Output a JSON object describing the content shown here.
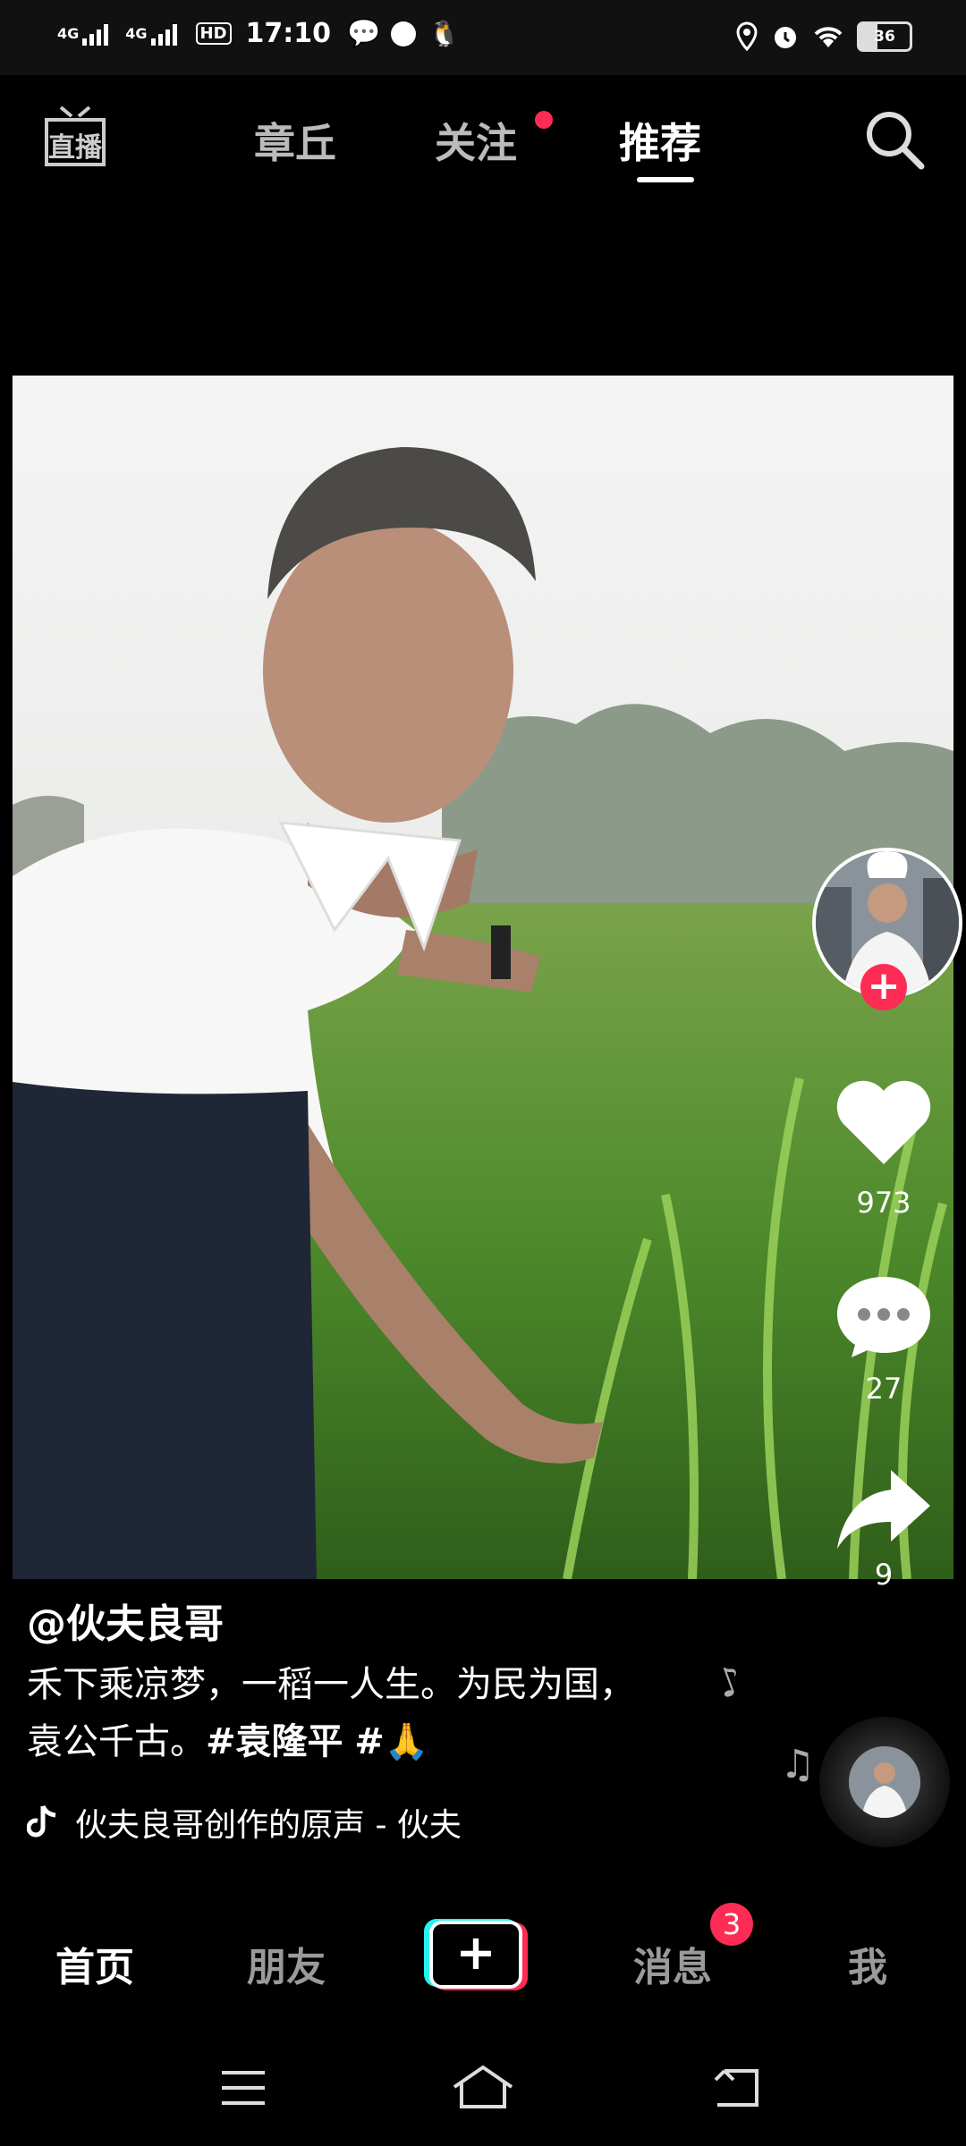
{
  "status_bar": {
    "network_1": "4G",
    "network_2": "4G",
    "hd_badge": "HD",
    "time": "17:10",
    "battery": "36"
  },
  "top_nav": {
    "live_label": "直播",
    "tabs": [
      {
        "label": "章丘",
        "active": false
      },
      {
        "label": "关注",
        "active": false,
        "dot": true
      },
      {
        "label": "推荐",
        "active": true
      }
    ]
  },
  "actions": {
    "likes": "973",
    "comments": "27",
    "shares": "9"
  },
  "post": {
    "author": "@伙夫良哥",
    "caption_text": "禾下乘凉梦，一稻一人生。为民为国，袁公千古。",
    "hashtag_1": "#袁隆平",
    "hashtag_2": "#🙏",
    "music": "伙夫良哥创作的原声 - 伙夫"
  },
  "bottom_nav": {
    "home": "首页",
    "friends": "朋友",
    "messages": "消息",
    "messages_badge": "3",
    "me": "我"
  },
  "colors": {
    "accent": "#fe2c55",
    "cyan": "#25f4ee"
  }
}
